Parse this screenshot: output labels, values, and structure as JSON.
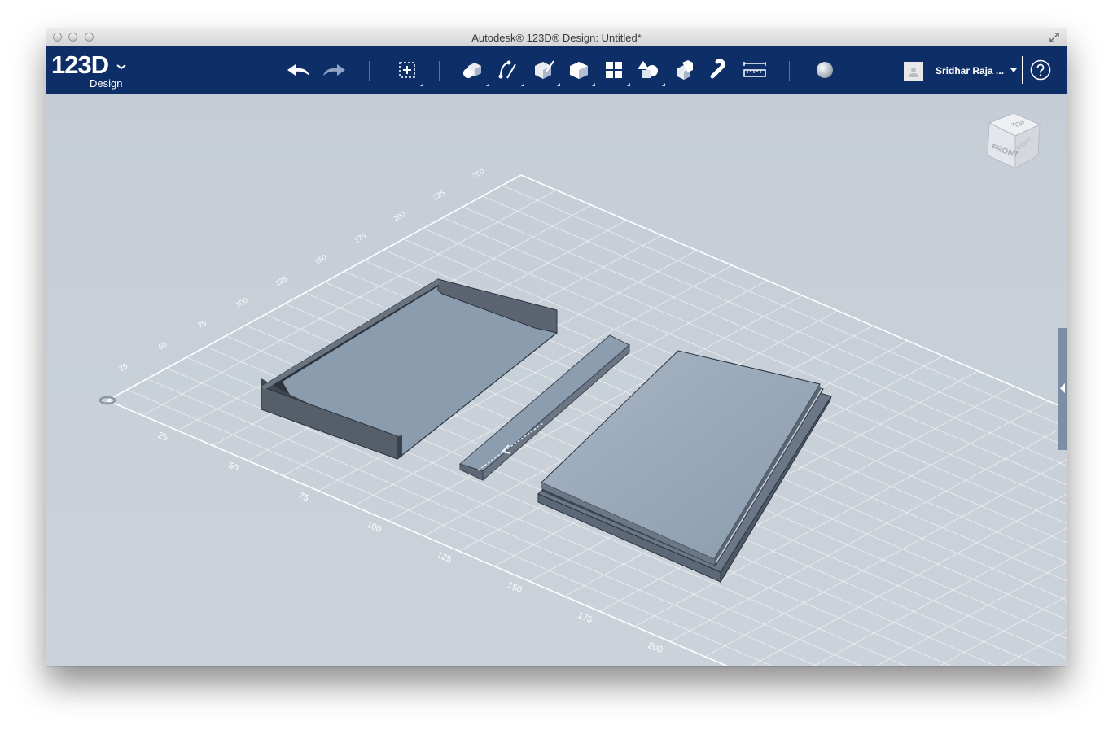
{
  "window": {
    "title": "Autodesk® 123D® Design: Untitled*"
  },
  "app": {
    "logo_main": "123D",
    "logo_sub": "Design"
  },
  "toolbar": {
    "tools": [
      {
        "name": "undo-icon"
      },
      {
        "name": "redo-icon"
      },
      {
        "name": "transform-icon"
      },
      {
        "name": "primitives-icon"
      },
      {
        "name": "sketch-icon"
      },
      {
        "name": "construct-icon"
      },
      {
        "name": "modify-icon"
      },
      {
        "name": "pattern-icon"
      },
      {
        "name": "grouping-icon"
      },
      {
        "name": "combine-icon"
      },
      {
        "name": "snap-icon"
      },
      {
        "name": "measure-icon"
      },
      {
        "name": "material-icon"
      }
    ]
  },
  "user": {
    "name": "Sridhar Raja ..."
  },
  "viewcube": {
    "top": "TOP",
    "front": "FRONT",
    "right": "RIGHT"
  },
  "grid": {
    "x_labels": [
      "25",
      "50",
      "75",
      "100",
      "125",
      "150",
      "175",
      "200"
    ],
    "y_labels": [
      "25",
      "50",
      "75",
      "100",
      "125",
      "150",
      "175",
      "200",
      "225",
      "250"
    ]
  },
  "colors": {
    "toolbar": "#0d2e66",
    "viewport": "#c9d0d8",
    "grid": "#ffffff"
  }
}
